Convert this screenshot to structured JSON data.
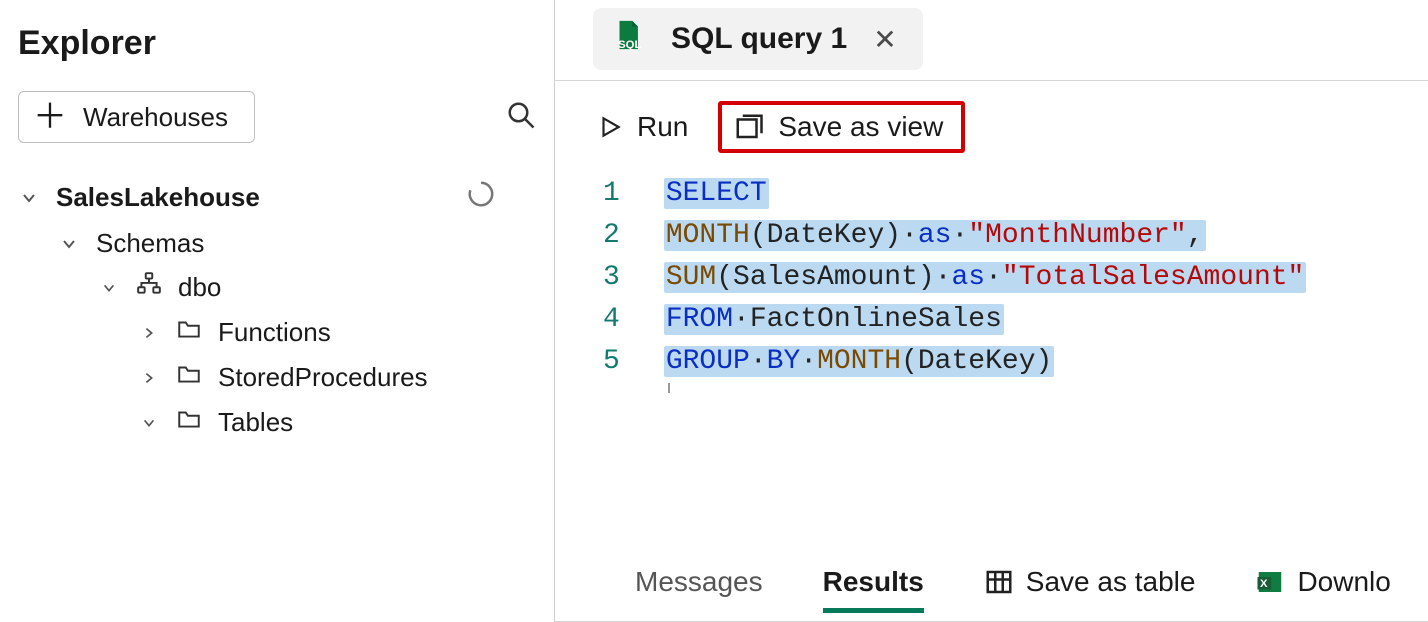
{
  "sidebar": {
    "title": "Explorer",
    "warehouses_button": "Warehouses",
    "tree": {
      "root": {
        "label": "SalesLakehouse"
      },
      "schemas": {
        "label": "Schemas"
      },
      "dbo": {
        "label": "dbo"
      },
      "functions": {
        "label": "Functions"
      },
      "sprocs": {
        "label": "StoredProcedures"
      },
      "tables": {
        "label": "Tables"
      }
    }
  },
  "tab": {
    "label": "SQL query 1"
  },
  "toolbar": {
    "run": "Run",
    "save_view": "Save as view"
  },
  "editor": {
    "line_numbers": [
      "1",
      "2",
      "3",
      "4",
      "5"
    ],
    "l1": {
      "select": "SELECT"
    },
    "l2": {
      "month": "MONTH",
      "lparen_id_rparen": "(DateKey)",
      "dot1": "·",
      "as": "as",
      "dot2": "·",
      "str": "\"MonthNumber\"",
      "comma": ","
    },
    "l3": {
      "sum": "SUM",
      "lparen_id_rparen": "(SalesAmount)",
      "dot1": "·",
      "as": "as",
      "dot2": "·",
      "str": "\"TotalSalesAmount\""
    },
    "l4": {
      "from": "FROM",
      "dot": "·",
      "tbl": "FactOnlineSales"
    },
    "l5": {
      "group": "GROUP",
      "dot1": "·",
      "by": "BY",
      "dot2": "·",
      "month": "MONTH",
      "args": "(DateKey)"
    }
  },
  "results": {
    "messages": "Messages",
    "results": "Results",
    "save_table": "Save as table",
    "download": "Downlo"
  }
}
